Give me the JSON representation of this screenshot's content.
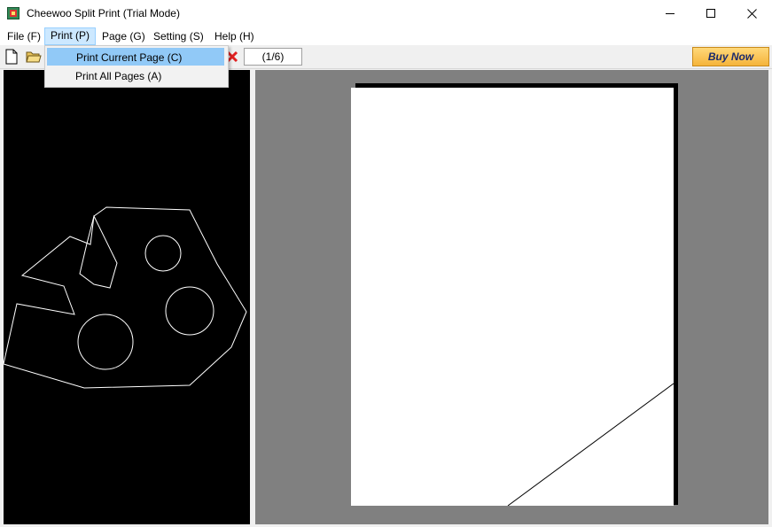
{
  "window": {
    "title": "Cheewoo Split Print (Trial Mode)"
  },
  "menubar": {
    "items": [
      {
        "id": "file",
        "label": "File (F)"
      },
      {
        "id": "print",
        "label": "Print (P)"
      },
      {
        "id": "page",
        "label": "Page (G)"
      },
      {
        "id": "setting",
        "label": "Setting (S)"
      },
      {
        "id": "help",
        "label": "Help (H)"
      }
    ]
  },
  "print_menu": {
    "items": [
      {
        "label": "Print Current Page (C)",
        "highlighted": true
      },
      {
        "label": "Print All Pages (A)",
        "highlighted": false
      }
    ]
  },
  "toolbar": {
    "page_counter": "(1/6)",
    "buy_now": "Buy Now",
    "icons": [
      "new-file-icon",
      "open-folder-icon",
      "delete-icon"
    ]
  },
  "colors": {
    "canvas_bg": "#000000",
    "preview_bg": "#808080",
    "menu_highlight": "#91c9f7",
    "buy_button": "#f5b43a"
  }
}
